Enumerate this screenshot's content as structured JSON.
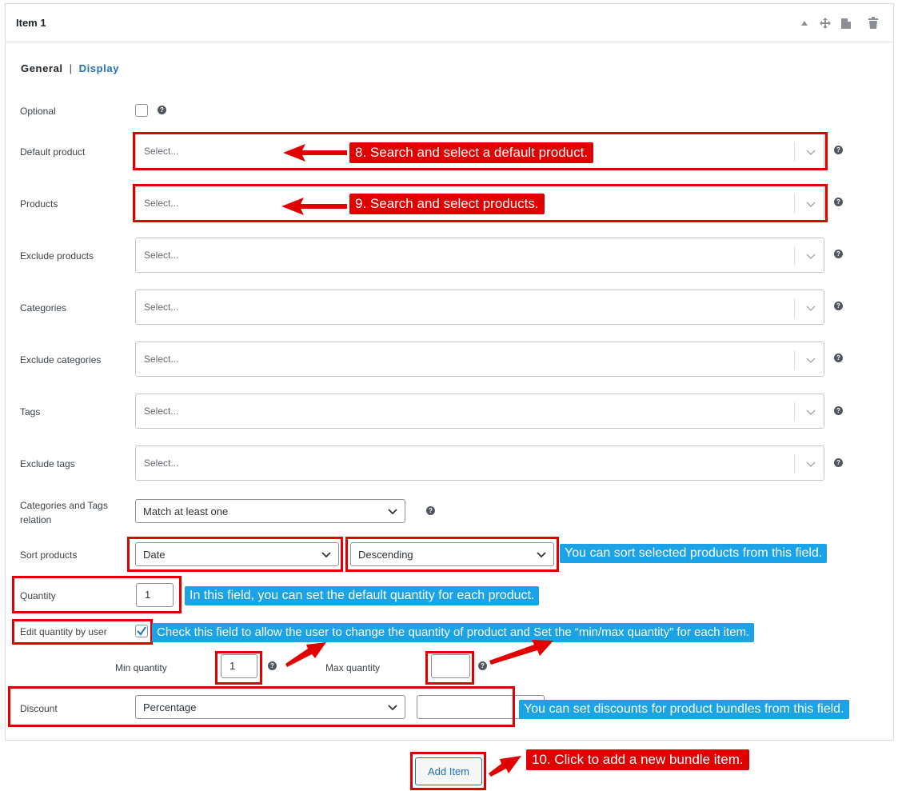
{
  "panel": {
    "title": "Item 1",
    "header_icons": [
      "collapse-up-icon",
      "move-icon",
      "copy-icon",
      "trash-icon"
    ]
  },
  "tabs": {
    "general": "General",
    "separator": "|",
    "display": "Display"
  },
  "fields": {
    "optional": {
      "label": "Optional",
      "checked": false
    },
    "default_product": {
      "label": "Default product",
      "placeholder": "Select..."
    },
    "products": {
      "label": "Products",
      "placeholder": "Select..."
    },
    "exclude_products": {
      "label": "Exclude products",
      "placeholder": "Select..."
    },
    "categories": {
      "label": "Categories",
      "placeholder": "Select..."
    },
    "exclude_categories": {
      "label": "Exclude categories",
      "placeholder": "Select..."
    },
    "tags": {
      "label": "Tags",
      "placeholder": "Select..."
    },
    "exclude_tags": {
      "label": "Exclude tags",
      "placeholder": "Select..."
    },
    "relation": {
      "label_line1": "Categories and Tags",
      "label_line2": "relation",
      "value": "Match at least one"
    },
    "sort": {
      "label": "Sort products",
      "orderby": "Date",
      "order": "Descending"
    },
    "quantity": {
      "label": "Quantity",
      "value": "1"
    },
    "edit_quantity": {
      "label": "Edit quantity by user",
      "checked": true
    },
    "min_quantity": {
      "label": "Min quantity",
      "value": "1"
    },
    "max_quantity": {
      "label": "Max quantity",
      "value": ""
    },
    "discount": {
      "label": "Discount",
      "type": "Percentage",
      "value": ""
    }
  },
  "add_item_label": "Add Item",
  "callouts": {
    "c8": "8. Search and select a default product.",
    "c9": "9. Search and select products.",
    "c10": "10. Click to add a new bundle item.",
    "sort": "You can sort selected products from this field.",
    "quantity": "In this field, you can set the default quantity for each product.",
    "edit_quantity": "Check this field to allow the user to change the quantity of product and Set the “min/max quantity” for each item.",
    "discount": "You can set discounts for product bundles from this field."
  },
  "colors": {
    "annotation_red": "#e10000",
    "annotation_blue": "#1aa3e6",
    "link_blue": "#2271b1"
  },
  "help_icon": "?"
}
